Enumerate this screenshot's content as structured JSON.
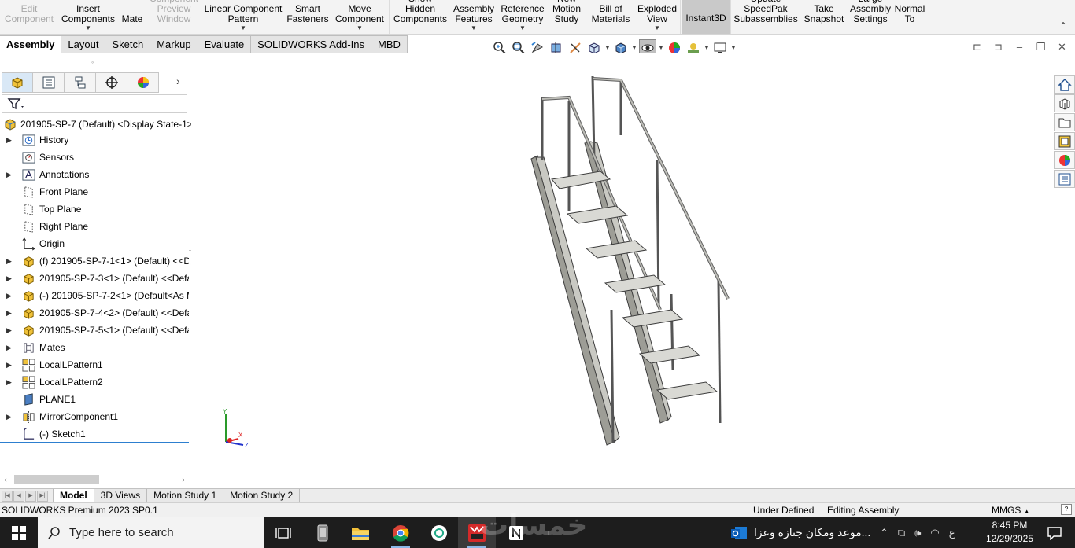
{
  "ribbon": {
    "buttons": [
      {
        "label": "Edit\nComponent",
        "disabled": true
      },
      {
        "label": "Insert\nComponents",
        "dropdown": true
      },
      {
        "label": "Mate"
      },
      {
        "label": "Component\nPreview\nWindow",
        "disabled": true
      },
      {
        "label": "Linear Component\nPattern",
        "dropdown": true
      },
      {
        "label": "Smart\nFasteners"
      },
      {
        "label": "Move\nComponent",
        "dropdown": true
      },
      {
        "label": "Show\nHidden\nComponents"
      },
      {
        "label": "Assembly\nFeatures",
        "dropdown": true
      },
      {
        "label": "Reference\nGeometry",
        "dropdown": true
      },
      {
        "label": "New\nMotion\nStudy"
      },
      {
        "label": "Bill of\nMaterials"
      },
      {
        "label": "Exploded\nView",
        "dropdown": true
      },
      {
        "label": "Instant3D",
        "active": true
      },
      {
        "label": "Update\nSpeedPak\nSubassemblies"
      },
      {
        "label": "Take\nSnapshot"
      },
      {
        "label": "Large\nAssembly\nSettings"
      },
      {
        "label": "Normal\nTo"
      }
    ]
  },
  "command_tabs": [
    "Assembly",
    "Layout",
    "Sketch",
    "Markup",
    "Evaluate",
    "SOLIDWORKS Add-Ins",
    "MBD"
  ],
  "active_command_tab": "Assembly",
  "tree": {
    "root": "201905-SP-7 (Default) <Display State-1>",
    "items": [
      {
        "label": "History",
        "icon": "history-icon",
        "expandable": true
      },
      {
        "label": "Sensors",
        "icon": "sensor-icon",
        "expandable": false
      },
      {
        "label": "Annotations",
        "icon": "annotation-icon",
        "expandable": true
      },
      {
        "label": "Front Plane",
        "icon": "plane-icon",
        "expandable": false
      },
      {
        "label": "Top Plane",
        "icon": "plane-icon",
        "expandable": false
      },
      {
        "label": "Right Plane",
        "icon": "plane-icon",
        "expandable": false
      },
      {
        "label": "Origin",
        "icon": "origin-icon",
        "expandable": false
      },
      {
        "label": "(f) 201905-SP-7-1<1> (Default) <<D",
        "icon": "part-icon",
        "expandable": true
      },
      {
        "label": "201905-SP-7-3<1> (Default) <<Defa",
        "icon": "part-icon",
        "expandable": true
      },
      {
        "label": "(-) 201905-SP-7-2<1> (Default<As M",
        "icon": "part-icon",
        "expandable": true
      },
      {
        "label": "201905-SP-7-4<2> (Default) <<Defa",
        "icon": "part-icon",
        "expandable": true
      },
      {
        "label": "201905-SP-7-5<1> (Default) <<Defa",
        "icon": "part-icon",
        "expandable": true
      },
      {
        "label": "Mates",
        "icon": "mates-icon",
        "expandable": true
      },
      {
        "label": "LocalLPattern1",
        "icon": "pattern-icon",
        "expandable": true
      },
      {
        "label": "LocalLPattern2",
        "icon": "pattern-icon",
        "expandable": true
      },
      {
        "label": "PLANE1",
        "icon": "ref-plane-icon",
        "expandable": false
      },
      {
        "label": "MirrorComponent1",
        "icon": "mirror-icon",
        "expandable": true
      },
      {
        "label": "(-) Sketch1",
        "icon": "sketch-icon",
        "expandable": false
      }
    ]
  },
  "triad": {
    "y": "Y",
    "x": "X",
    "z": "Z"
  },
  "model_tabs": [
    "Model",
    "3D Views",
    "Motion Study 1",
    "Motion Study 2"
  ],
  "active_model_tab": "Model",
  "status": {
    "product": "SOLIDWORKS Premium 2023 SP0.1",
    "definition": "Under Defined",
    "mode": "Editing Assembly",
    "units": "MMGS"
  },
  "taskbar": {
    "search_placeholder": "Type here to search",
    "notification": "موعد ومكان جنازة وعزا...",
    "lang": "ع",
    "time": "8:45 PM",
    "date": "12/29/2025",
    "watermark": "خمسات"
  },
  "colors": {
    "accent": "#2d7fcf",
    "ribbon_bg": "#f3f3f3",
    "taskbar_bg": "#1d1d1d",
    "model_steel": "#9a9a94"
  }
}
